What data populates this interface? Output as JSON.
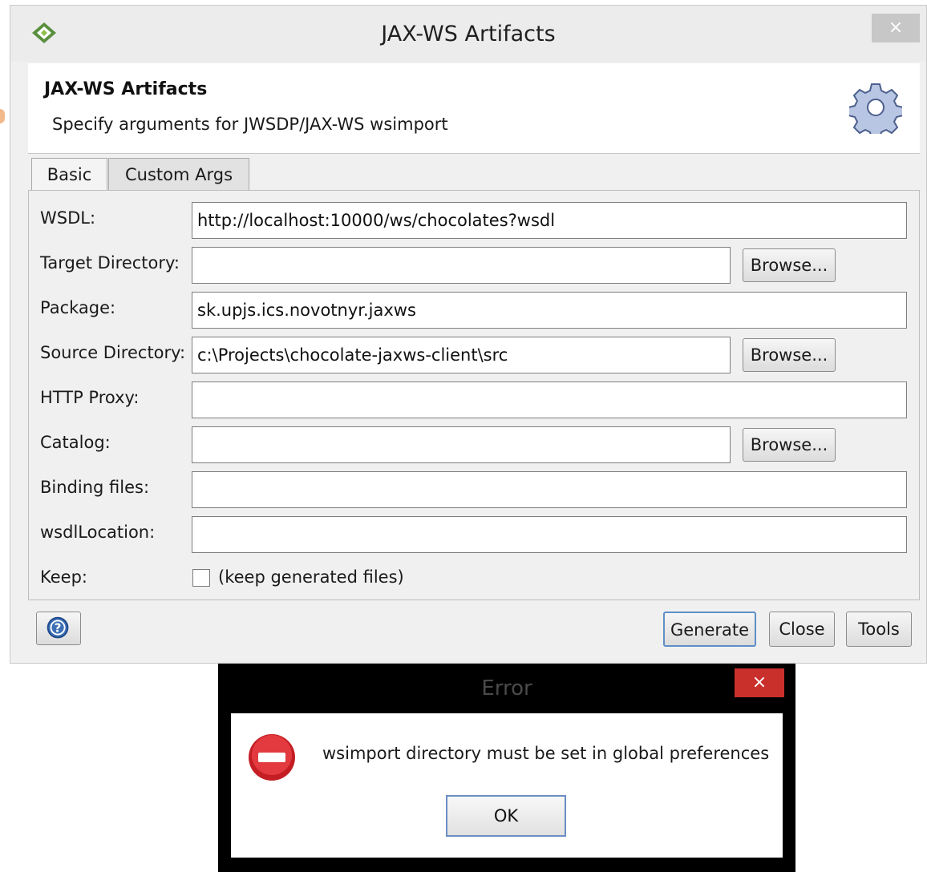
{
  "window": {
    "title": "JAX-WS Artifacts",
    "close_symbol": "×",
    "app_icon": "eclipse-diamond-icon"
  },
  "header": {
    "title": "JAX-WS Artifacts",
    "subtitle": "Specify arguments for JWSDP/JAX-WS wsimport",
    "icon": "gear-icon"
  },
  "tabs": [
    {
      "label": "Basic",
      "selected": true
    },
    {
      "label": "Custom Args",
      "selected": false
    }
  ],
  "form": {
    "wsdl": {
      "label": "WSDL:",
      "value": "http://localhost:10000/ws/chocolates?wsdl"
    },
    "target_directory": {
      "label": "Target Directory:",
      "value": ""
    },
    "package": {
      "label": "Package:",
      "value": "sk.upjs.ics.novotnyr.jaxws"
    },
    "source_directory": {
      "label": "Source Directory:",
      "value": "c:\\Projects\\chocolate-jaxws-client\\src"
    },
    "http_proxy": {
      "label": "HTTP Proxy:",
      "value": ""
    },
    "catalog": {
      "label": "Catalog:",
      "value": ""
    },
    "binding_files": {
      "label": "Binding files:",
      "value": ""
    },
    "wsdl_location": {
      "label": "wsdlLocation:",
      "value": ""
    },
    "keep": {
      "label": "Keep:",
      "checkbox_label": "(keep generated files)",
      "checked": false
    },
    "browse_label": "Browse..."
  },
  "buttons": {
    "generate": "Generate",
    "close": "Close",
    "tools": "Tools",
    "help_icon": "help-icon"
  },
  "error_dialog": {
    "title": "Error",
    "close_symbol": "×",
    "message": "wsimport directory must be set in global preferences",
    "ok": "OK",
    "icon": "error-stop-icon"
  },
  "colors": {
    "window_bg": "#f0f0f0",
    "error_close_bg": "#c9302c",
    "error_icon": "#d9262c",
    "default_button_border": "#5e8fc7"
  }
}
